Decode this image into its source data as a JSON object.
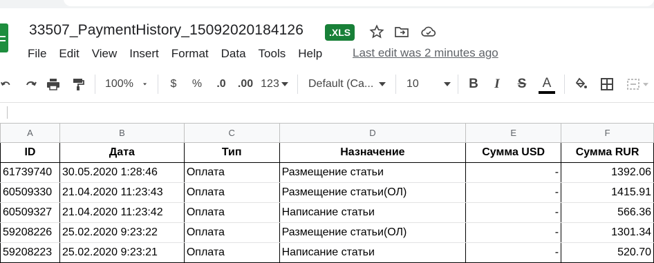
{
  "document": {
    "title": "33507_PaymentHistory_15092020184126",
    "badge": ".XLS",
    "last_edit": "Last edit was 2 minutes ago"
  },
  "menu": [
    "File",
    "Edit",
    "View",
    "Insert",
    "Format",
    "Data",
    "Tools",
    "Help"
  ],
  "toolbar": {
    "zoom": "100%",
    "currency": "$",
    "percent": "%",
    "decrease_decimal": ".0",
    "increase_decimal": ".00",
    "more_formats": "123",
    "font": "Default (Ca...",
    "font_size": "10",
    "bold": "B",
    "italic": "I",
    "strikethrough": "S",
    "text_color": "A",
    "icons": [
      "undo-icon",
      "redo-icon",
      "print-icon",
      "paint-format-icon",
      "fill-color-icon",
      "borders-icon",
      "merge-cells-icon"
    ],
    "text_color_hex": "#000000"
  },
  "sheet": {
    "column_letters": [
      "A",
      "B",
      "C",
      "D",
      "E",
      "F"
    ],
    "headers": [
      "ID",
      "Дата",
      "Тип",
      "Назначение",
      "Сумма USD",
      "Сумма RUR"
    ],
    "rows": [
      [
        "61739740",
        "30.05.2020 1:28:46",
        "Оплата",
        "Размещение статьи",
        "-",
        "1392.06"
      ],
      [
        "60509330",
        "21.04.2020 11:23:43",
        "Оплата",
        "Размещение статьи(ОЛ)",
        "-",
        "1415.91"
      ],
      [
        "60509327",
        "21.04.2020 11:23:42",
        "Оплата",
        "Написание статьи",
        "-",
        "566.36"
      ],
      [
        "59208226",
        "25.02.2020 9:23:22",
        "Оплата",
        "Размещение статьи(ОЛ)",
        "-",
        "1301.34"
      ],
      [
        "59208223",
        "25.02.2020 9:23:21",
        "Оплата",
        "Написание статьи",
        "-",
        "520.70"
      ]
    ]
  },
  "colors": {
    "accent_green": "#188038",
    "text": "#202124",
    "muted": "#5f6368"
  }
}
